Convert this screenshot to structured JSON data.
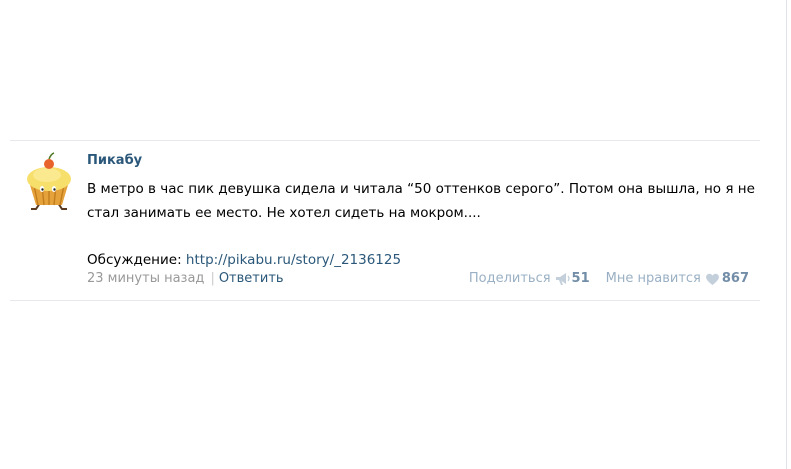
{
  "post": {
    "author": "Пикабу",
    "text": "В метро в час пик девушка сидела и читала “50 оттенков серого”. Потом она вышла, но я не стал занимать ее место. Не хотел сидеть на мокром....",
    "discussion_label": "Обсуждение: ",
    "discussion_link": "http://pikabu.ru/story/_2136125",
    "time": "23 минуты назад",
    "separator": "|",
    "reply_label": "Ответить",
    "share_label": "Поделиться",
    "share_count": "51",
    "like_label": "Мне нравится",
    "like_count": "867"
  },
  "colors": {
    "link": "#2b587a",
    "muted": "#999999",
    "counter": "#728da7"
  },
  "icons": {
    "avatar": "cupcake-avatar",
    "share": "megaphone-icon",
    "like": "heart-icon"
  }
}
